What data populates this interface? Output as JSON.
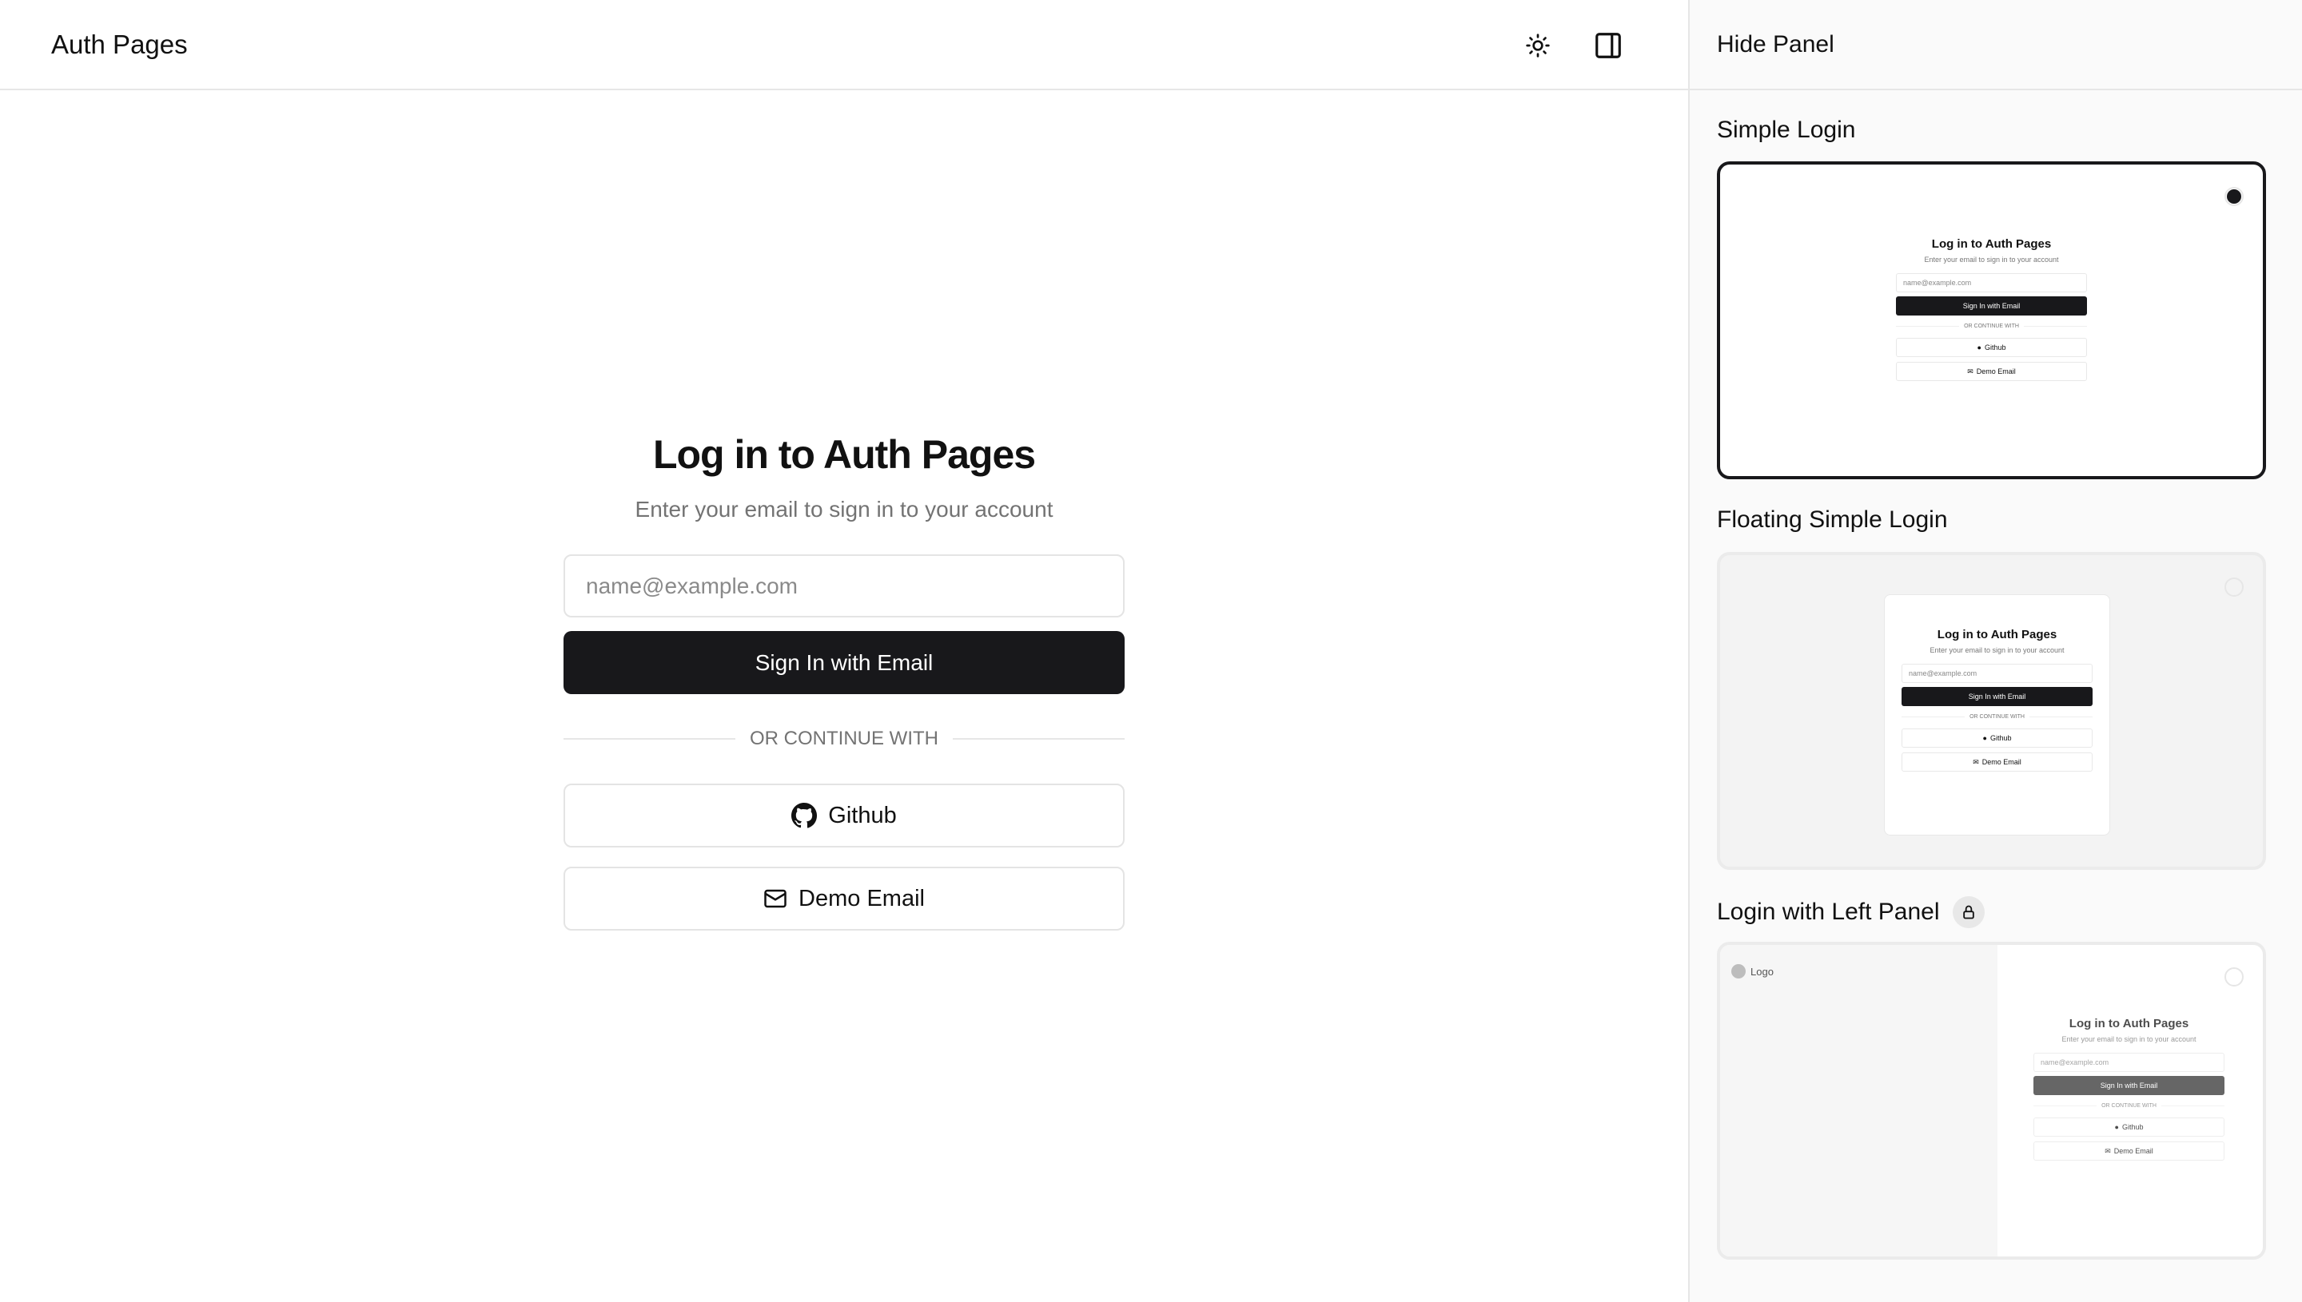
{
  "header": {
    "title": "Auth Pages",
    "theme_icon": "sun-icon",
    "panel_icon": "sidebar-right-icon"
  },
  "form": {
    "title": "Log in to Auth Pages",
    "subtitle": "Enter your email to sign in to your account",
    "email_placeholder": "name@example.com",
    "submit_label": "Sign In with Email",
    "divider": "OR CONTINUE WITH",
    "github_label": "Github",
    "demo_label": "Demo Email"
  },
  "panel": {
    "hide_label": "Hide Panel",
    "templates": [
      {
        "name": "Simple Login",
        "selected": true
      },
      {
        "name": "Floating Simple Login",
        "selected": false
      },
      {
        "name": "Login with Left Panel",
        "selected": false,
        "locked": true,
        "logo_label": "Logo"
      }
    ]
  }
}
